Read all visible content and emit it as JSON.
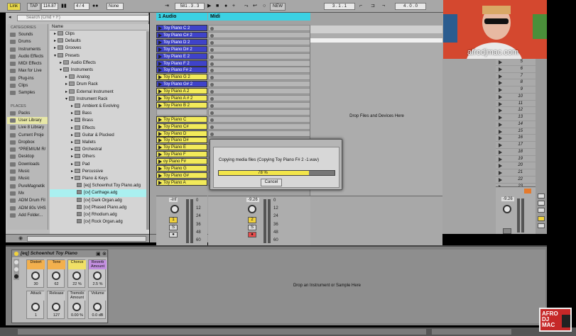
{
  "toolbar": {
    "link": "Link",
    "tap": "TAP",
    "bpm": "116.87",
    "time_sig": "4 / 4",
    "quantize": "None",
    "position": "581 . 3 . 3",
    "new_label": "NEW",
    "loop_start": "3 . 1 . 1",
    "loop_len": "4 . 0 . 0"
  },
  "browser": {
    "search_placeholder": "Search (Cmd + F)",
    "categories_title": "CATEGORIES",
    "categories": [
      "Sounds",
      "Drums",
      "Instruments",
      "Audio Effects",
      "MIDI Effects",
      "Max for Live",
      "Plug-ins",
      "Clips",
      "Samples"
    ],
    "places_title": "PLACES",
    "places": [
      "Packs",
      "User Library",
      "Live 8 Library",
      "Current Proje",
      "Dropbox",
      "*PREMIUM R/",
      "Desktop",
      "Downloads",
      "Music",
      "Music",
      "PureMagnetik",
      "Mx",
      "ADM Drum Fil",
      "ADM 80s VHS",
      "Add Folder..."
    ],
    "name_col": "Name",
    "tree": [
      "Clips",
      "Defaults",
      "Grooves",
      "Presets",
      "Audio Effects",
      "Instruments",
      "Analog",
      "Drum Rack",
      "External Instrument",
      "Instrument Rack",
      "Ambient & Evolving",
      "Bass",
      "Brass",
      "Effects",
      "Guitar & Plucked",
      "Mallets",
      "Orchestral",
      "Others",
      "Pad",
      "Percussive",
      "Piano & Keys",
      "[eq] Schoenhut Toy Piano.adg",
      "[cv] Carthage.adg",
      "[cv] Dark Organ.adg",
      "[cv] Phased Piano.adg",
      "[cv] Rhodium.adg",
      "[cv] Rock Organ.adg"
    ]
  },
  "session": {
    "track1": "1 Audio",
    "track2": "Midi",
    "clips": [
      "Toy Piano C 2",
      "Toy Piano C# 2",
      "Toy Piano D 2",
      "Toy Piano D# 2",
      "Toy Piano E 2",
      "Toy Piano F 2",
      "Toy Piano F# 2",
      "Toy Piano G 2",
      "Toy Piano G# 2",
      "Toy Piano A 2",
      "Toy Piano A # 2",
      "Toy Piano B 2",
      "Toy Piano C",
      "Toy Piano C#",
      "Toy Piano D",
      "Toy Piano D#",
      "Toy Piano E",
      "Toy Piano F",
      "oy Piano F#",
      "Toy Piano G",
      "Toy Piano G#",
      "Toy Piano A"
    ],
    "drop_text": "Drop Files and Devices Here",
    "scenes": [
      "5",
      "6",
      "7",
      "8",
      "9",
      "10",
      "11",
      "12",
      "13",
      "14",
      "15",
      "16",
      "17",
      "18",
      "19",
      "20",
      "21",
      "22",
      "23"
    ],
    "mixer": {
      "vol1": "-inf",
      "vol2": "-9.26",
      "vol3": "-9.26",
      "track_num1": "1",
      "track_num2": "2",
      "scale": [
        "0",
        "12",
        "24",
        "36",
        "48",
        "60"
      ]
    }
  },
  "dialog": {
    "message": "Copying media files (Copying Toy Piano F# 2 -1.wav)",
    "progress_label": "78 %",
    "progress": 0.78,
    "cancel": "Cancel"
  },
  "webcam": {
    "caption": "afrodjmac.com"
  },
  "device": {
    "name": "[eq] Schoenhut Toy Piano",
    "macros": [
      {
        "label": "Distort",
        "value": "30"
      },
      {
        "label": "Tone",
        "value": "62"
      },
      {
        "label": "Chorus",
        "value": "22 %"
      },
      {
        "label": "Reverb Amount",
        "value": "2.5 %"
      },
      {
        "label": "Attack",
        "value": "1"
      },
      {
        "label": "Release",
        "value": "127"
      },
      {
        "label": "Tremolo Amount",
        "value": "0.00 %"
      },
      {
        "label": "Volume",
        "value": "0.0 dB"
      }
    ],
    "drop_text": "Drop an Instrument or Sample Here"
  },
  "logo": {
    "text": "AFRO DJ MAC"
  },
  "colors": {
    "clip_yellow": "#f2ea5a",
    "clip_blue": "#3f43c9",
    "progress": "#f2e54a",
    "selection_cyan": "#aaf0f0"
  }
}
